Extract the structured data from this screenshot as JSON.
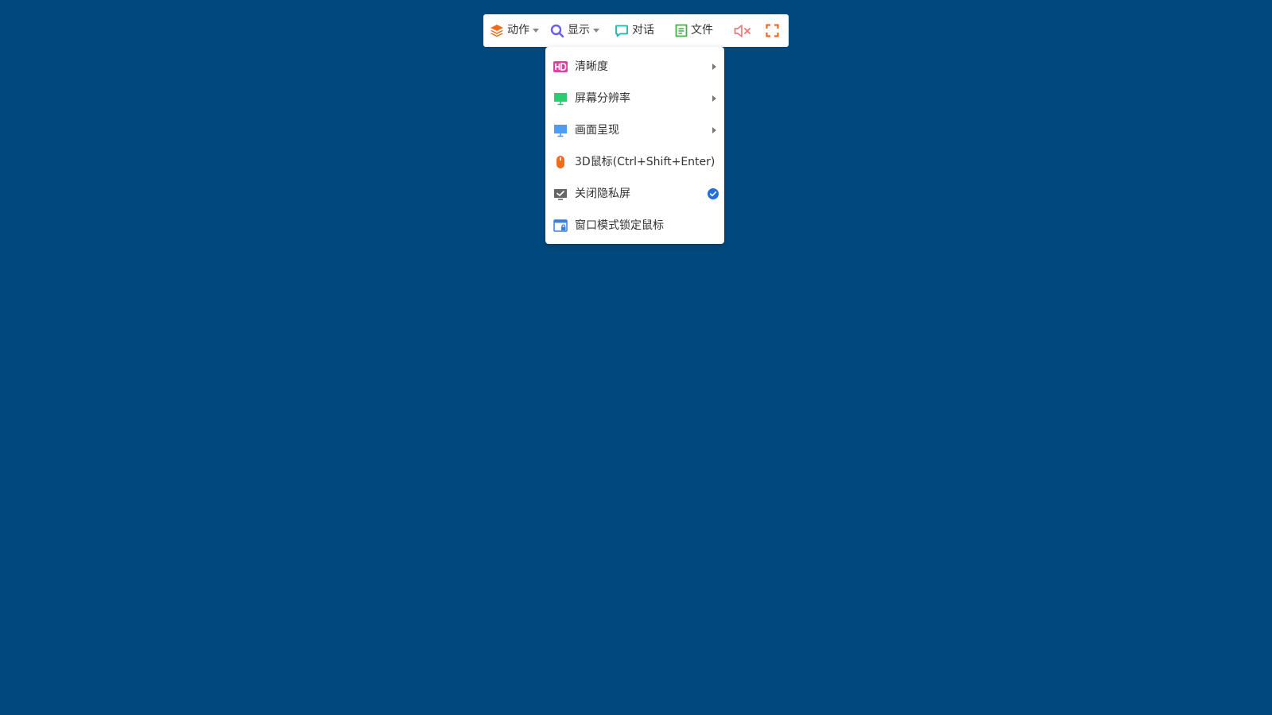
{
  "toolbar": {
    "action": {
      "label": "动作",
      "icon": "layers-icon",
      "color": "#f26a1b"
    },
    "display": {
      "label": "显示",
      "icon": "search-icon",
      "color": "#6b5cf2"
    },
    "chat": {
      "label": "对话",
      "icon": "chat-bubble-icon",
      "color": "#1fb5a7"
    },
    "file": {
      "label": "文件",
      "icon": "file-list-icon",
      "color": "#3fb53f"
    },
    "mute": {
      "icon": "speaker-muted-icon",
      "color": "#f07575"
    },
    "fullscreen": {
      "icon": "fullscreen-icon",
      "color": "#f26a1b"
    }
  },
  "display_menu": {
    "items": [
      {
        "label": "清晰度",
        "icon": "hd-icon",
        "color": "#e040a0",
        "has_submenu": true
      },
      {
        "label": "屏幕分辨率",
        "icon": "monitor-icon",
        "color": "#2ecc71",
        "has_submenu": true
      },
      {
        "label": "画面呈现",
        "icon": "display-icon",
        "color": "#4d9cf5",
        "has_submenu": true
      },
      {
        "label": "3D鼠标(Ctrl+Shift+Enter)",
        "icon": "mouse-icon",
        "color": "#f26a1b",
        "has_submenu": false
      },
      {
        "label": "关闭隐私屏",
        "icon": "privacy-screen-icon",
        "color": "#666666",
        "checked": true
      },
      {
        "label": "窗口模式锁定鼠标",
        "icon": "window-lock-icon",
        "color": "#3d7ee0",
        "has_submenu": false
      }
    ],
    "check_color": "#1e6fe0"
  }
}
